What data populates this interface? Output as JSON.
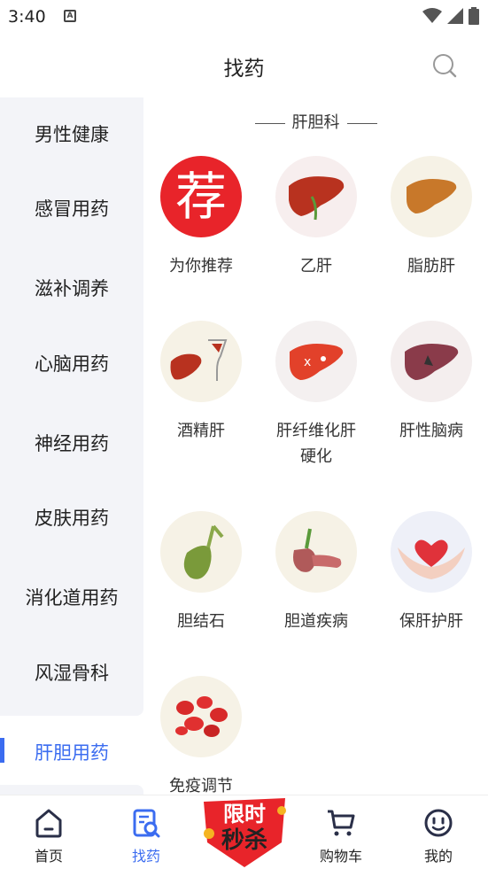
{
  "status_bar": {
    "time": "3:40",
    "notification_glyph": "A"
  },
  "header": {
    "title": "找药"
  },
  "sidebar": {
    "items": [
      {
        "label": "男性健康",
        "active": false
      },
      {
        "label": "感冒用药",
        "active": false
      },
      {
        "label": "滋补调养",
        "active": false
      },
      {
        "label": "心脑用药",
        "active": false
      },
      {
        "label": "神经用药",
        "active": false
      },
      {
        "label": "皮肤用药",
        "active": false
      },
      {
        "label": "消化道用药",
        "active": false
      },
      {
        "label": "风湿骨科",
        "active": false
      },
      {
        "label": "肝胆用药",
        "active": true
      }
    ]
  },
  "section": {
    "title": "肝胆科"
  },
  "categories": [
    {
      "label": "为你推荐",
      "icon": "recommend-icon",
      "badge_text": "荐"
    },
    {
      "label": "乙肝",
      "icon": "liver-icon"
    },
    {
      "label": "脂肪肝",
      "icon": "fatty-liver-icon"
    },
    {
      "label": "酒精肝",
      "icon": "alcohol-liver-icon"
    },
    {
      "label": "肝纤维化肝硬化",
      "icon": "fibrosis-liver-icon"
    },
    {
      "label": "肝性脑病",
      "icon": "hepatic-encephalopathy-icon"
    },
    {
      "label": "胆结石",
      "icon": "gallbladder-icon"
    },
    {
      "label": "胆道疾病",
      "icon": "biliary-icon"
    },
    {
      "label": "保肝护肝",
      "icon": "heart-hands-icon"
    },
    {
      "label": "免疫调节",
      "icon": "blood-cells-icon"
    }
  ],
  "bottom_nav": {
    "items": [
      {
        "label": "首页",
        "icon": "home-icon",
        "active": false
      },
      {
        "label": "找药",
        "icon": "find-drug-icon",
        "active": true
      },
      {
        "label": "购物车",
        "icon": "cart-icon",
        "active": false
      },
      {
        "label": "我的",
        "icon": "profile-icon",
        "active": false
      }
    ],
    "flash_sale": {
      "line1": "限时",
      "line2": "秒杀"
    }
  },
  "colors": {
    "accent": "#3b6cf0",
    "sidebar_bg": "#f3f4f8",
    "recommend_red": "#e8242a"
  }
}
